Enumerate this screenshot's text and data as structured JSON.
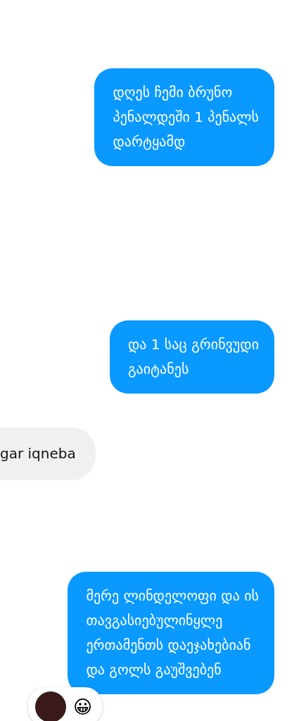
{
  "messages": [
    {
      "kind": "sent",
      "text": "დღეს ჩემი ბრუნო\nპენალდეში 1 პენალს\nდარტყამდ"
    },
    {
      "kind": "sent",
      "text": "და 1 საც გრინვუდი\nგაიტანეს"
    },
    {
      "kind": "received",
      "text": "gar iqneba"
    },
    {
      "kind": "sent",
      "text": "მერე ლინდელოფი და ის\nთავგასიებულინყლე\nერთამენთს დაეჯახებიან\nდა გოლს გაუშვებენ",
      "reactions": [
        "😀"
      ]
    }
  ]
}
